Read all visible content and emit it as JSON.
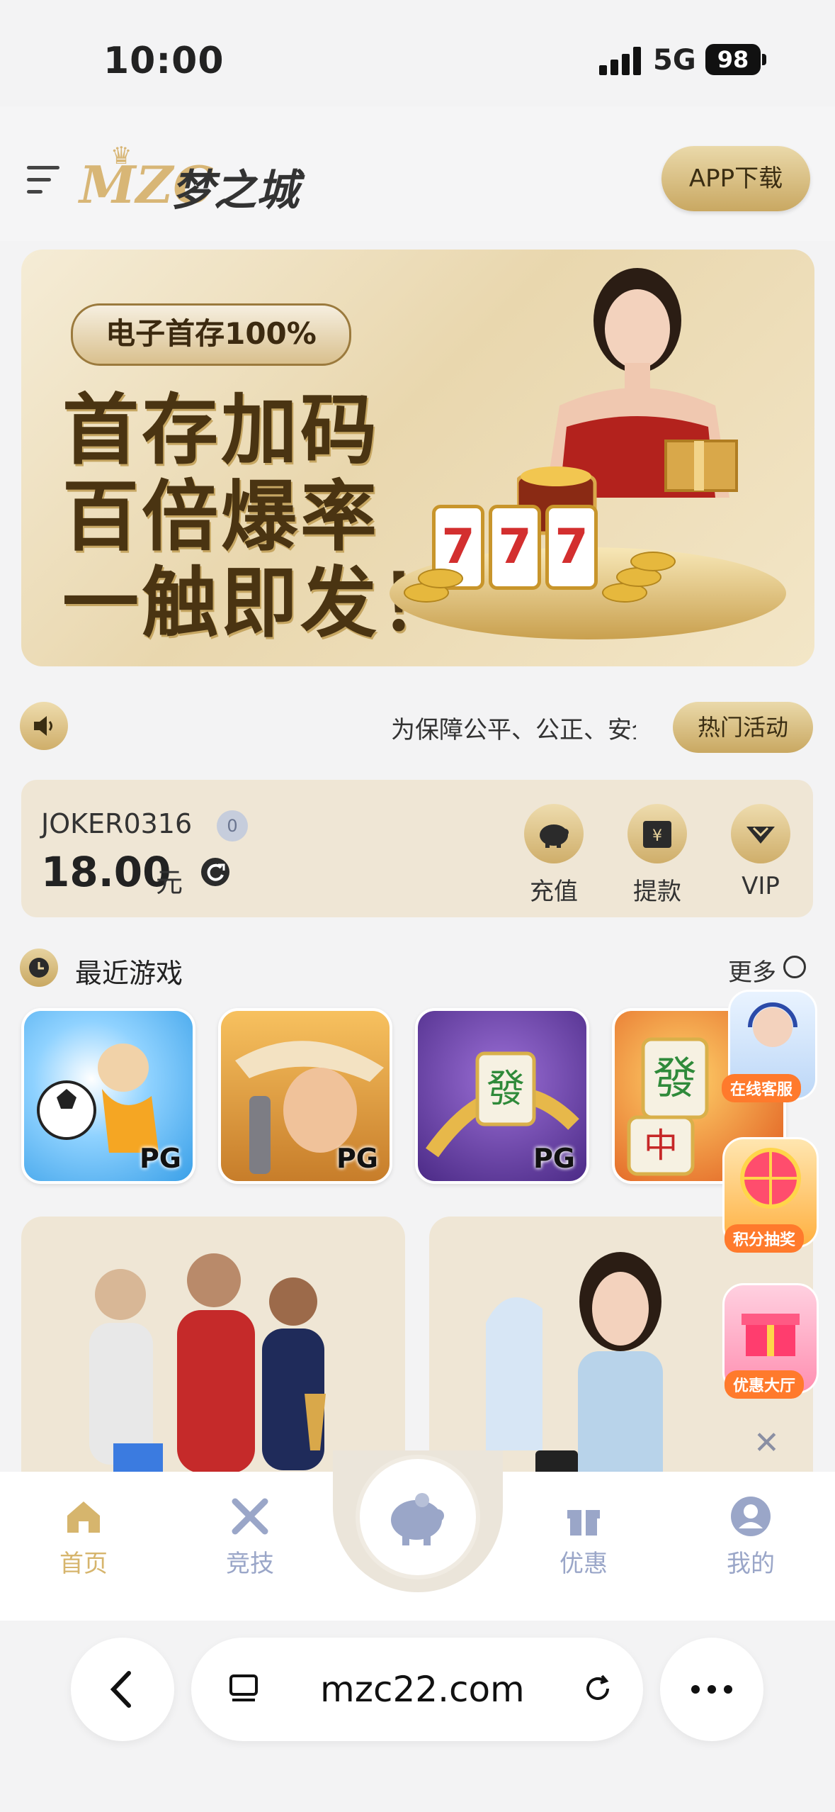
{
  "status_bar": {
    "time": "10:00",
    "network": "5G",
    "battery": "98"
  },
  "header": {
    "logo_mark": "MZC",
    "logo_name": "梦之城",
    "app_download": "APP下载"
  },
  "banner": {
    "badge": "电子首存100%",
    "lines": [
      "首存加码",
      "百倍爆率",
      "一触即发！"
    ],
    "slot_digits": [
      "7",
      "7",
      "7"
    ]
  },
  "notice": {
    "text": "为保障公平、公正、安全",
    "hot_button": "热门活动"
  },
  "account": {
    "username": "JOKER0316",
    "vip_level": "0",
    "balance": "18.00",
    "unit": "元",
    "actions": [
      {
        "label": "充值",
        "icon": "piggy-bank-icon"
      },
      {
        "label": "提款",
        "icon": "withdraw-icon"
      },
      {
        "label": "VIP",
        "icon": "diamond-icon"
      }
    ]
  },
  "recent_games": {
    "title": "最近游戏",
    "more": "更多",
    "items": [
      {
        "provider": "PG",
        "theme": "soccer-kid"
      },
      {
        "provider": "PG",
        "theme": "cowgirl"
      },
      {
        "provider": "PG",
        "theme": "mahjong-dragon"
      },
      {
        "provider": "PG",
        "theme": "mahjong-tiles"
      }
    ]
  },
  "floating": {
    "service": "在线客服",
    "lottery": "积分抽奖",
    "promo_hall": "优惠大厅"
  },
  "bottom_nav": {
    "items": [
      {
        "label": "首页",
        "icon": "home-icon",
        "active": true
      },
      {
        "label": "竞技",
        "icon": "swords-icon",
        "active": false
      },
      {
        "label": "优惠",
        "icon": "gift-icon",
        "active": false
      },
      {
        "label": "我的",
        "icon": "user-icon",
        "active": false
      }
    ],
    "center_icon": "piggy-bank-icon"
  },
  "browser": {
    "url": "mzc22.com"
  },
  "colors": {
    "gold": "#cfae6a",
    "gold_light": "#ead9aa",
    "card_bg": "#efe6d5",
    "nav_active": "#d6b56d",
    "nav_inactive": "#9aa6c8"
  }
}
